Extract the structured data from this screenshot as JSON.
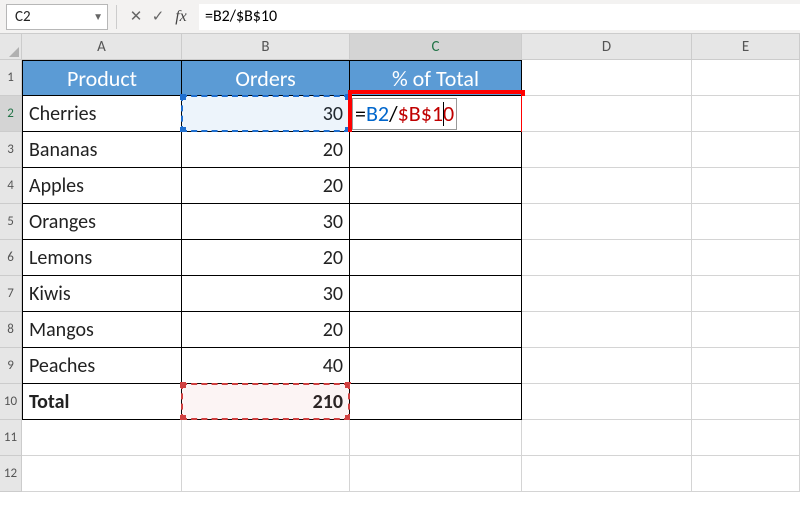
{
  "nameBox": "C2",
  "formulaBar": "=B2/$B$10",
  "columns": [
    "A",
    "B",
    "C",
    "D",
    "E"
  ],
  "rowNums": [
    "1",
    "2",
    "3",
    "4",
    "5",
    "6",
    "7",
    "8",
    "9",
    "10",
    "11",
    "12"
  ],
  "headers": {
    "A": "Product",
    "B": "Orders",
    "C": "% of Total"
  },
  "rows": [
    {
      "A": "Cherries",
      "B": "30"
    },
    {
      "A": "Bananas",
      "B": "20"
    },
    {
      "A": "Apples",
      "B": "20"
    },
    {
      "A": "Oranges",
      "B": "30"
    },
    {
      "A": "Lemons",
      "B": "20"
    },
    {
      "A": "Kiwis",
      "B": "30"
    },
    {
      "A": "Mangos",
      "B": "20"
    },
    {
      "A": "Peaches",
      "B": "40"
    }
  ],
  "total": {
    "label": "Total",
    "value": "210"
  },
  "c2formula": {
    "eq": "=",
    "ref1": "B2",
    "slash": "/",
    "ref2": "$B$10"
  }
}
